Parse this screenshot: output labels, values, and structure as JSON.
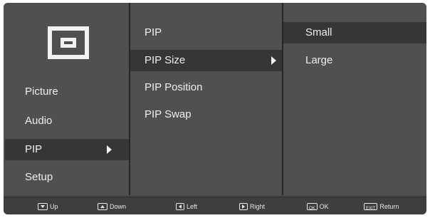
{
  "main_menu": {
    "items": [
      {
        "label": "Picture"
      },
      {
        "label": "Audio"
      },
      {
        "label": "PIP"
      },
      {
        "label": "Setup"
      }
    ],
    "selected": "PIP"
  },
  "pip_menu": {
    "items": [
      {
        "label": "PIP"
      },
      {
        "label": "PIP Size"
      },
      {
        "label": "PIP Position"
      },
      {
        "label": "PIP Swap"
      }
    ],
    "selected": "PIP Size"
  },
  "size_menu": {
    "items": [
      {
        "label": "Small"
      },
      {
        "label": "Large"
      }
    ],
    "selected": "Small"
  },
  "footer": {
    "up": {
      "key_icon": "down-triangle-key-icon",
      "label": "Up"
    },
    "down": {
      "key_icon": "up-triangle-key-icon",
      "label": "Down"
    },
    "left": {
      "key_icon": "left-triangle-key-icon",
      "label": "Left"
    },
    "right": {
      "key_icon": "right-triangle-key-icon",
      "label": "Right"
    },
    "ok": {
      "key_text": "OK",
      "label": "OK"
    },
    "return": {
      "key_text": "EXIT",
      "label": "Return"
    }
  },
  "colors": {
    "panel": "#505050",
    "selected_row": "#363636",
    "text": "#eeeeee",
    "footer": "#3e3e3e"
  }
}
